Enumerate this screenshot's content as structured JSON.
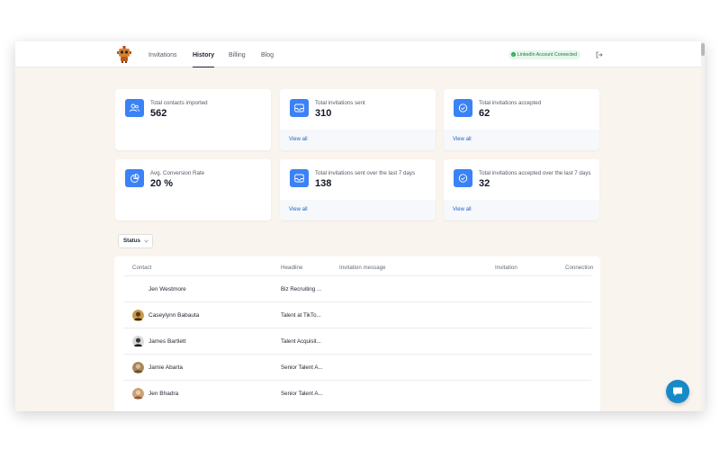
{
  "nav": {
    "items": [
      {
        "label": "Invitations",
        "active": false
      },
      {
        "label": "History",
        "active": true
      },
      {
        "label": "Billing",
        "active": false
      },
      {
        "label": "Blog",
        "active": false
      }
    ]
  },
  "header": {
    "status_badge": "LinkedIn Account Connected",
    "status_color": "#23a455"
  },
  "stats": [
    {
      "icon": "contacts-icon",
      "label": "Total contacts imported",
      "value": "562",
      "link": ""
    },
    {
      "icon": "inbox-icon",
      "label": "Total invitations sent",
      "value": "310",
      "link": "View all"
    },
    {
      "icon": "check-circle-icon",
      "label": "Total invitations accepted",
      "value": "62",
      "link": "View all"
    },
    {
      "icon": "pie-chart-icon",
      "label": "Avg. Conversion Rate",
      "value": "20 %",
      "link": ""
    },
    {
      "icon": "inbox-icon",
      "label": "Total invitations sent over the last 7 days",
      "value": "138",
      "link": "View all"
    },
    {
      "icon": "check-circle-icon",
      "label": "Total invitations accepted over the last 7 days",
      "value": "32",
      "link": "View all"
    }
  ],
  "filter": {
    "label": "Status"
  },
  "table": {
    "columns": [
      "Contact",
      "Headline",
      "Invitation message",
      "Invitation",
      "Connection"
    ],
    "rows": [
      {
        "name": "Jen Westmore",
        "headline": "Biz Recruiting ...",
        "avatar": false
      },
      {
        "name": "Caseylynn Babauta",
        "headline": "Talent at TikTo...",
        "avatar": true
      },
      {
        "name": "James Bartlett",
        "headline": "Talent Acquisit...",
        "avatar": true
      },
      {
        "name": "Jamie Abarta",
        "headline": "Senior Talent A...",
        "avatar": true
      },
      {
        "name": "Jen Bhadra",
        "headline": "Senior Talent A...",
        "avatar": true
      }
    ]
  },
  "colors": {
    "accent": "#3b82f6",
    "link": "#2463c7",
    "chat": "#1889c7"
  }
}
